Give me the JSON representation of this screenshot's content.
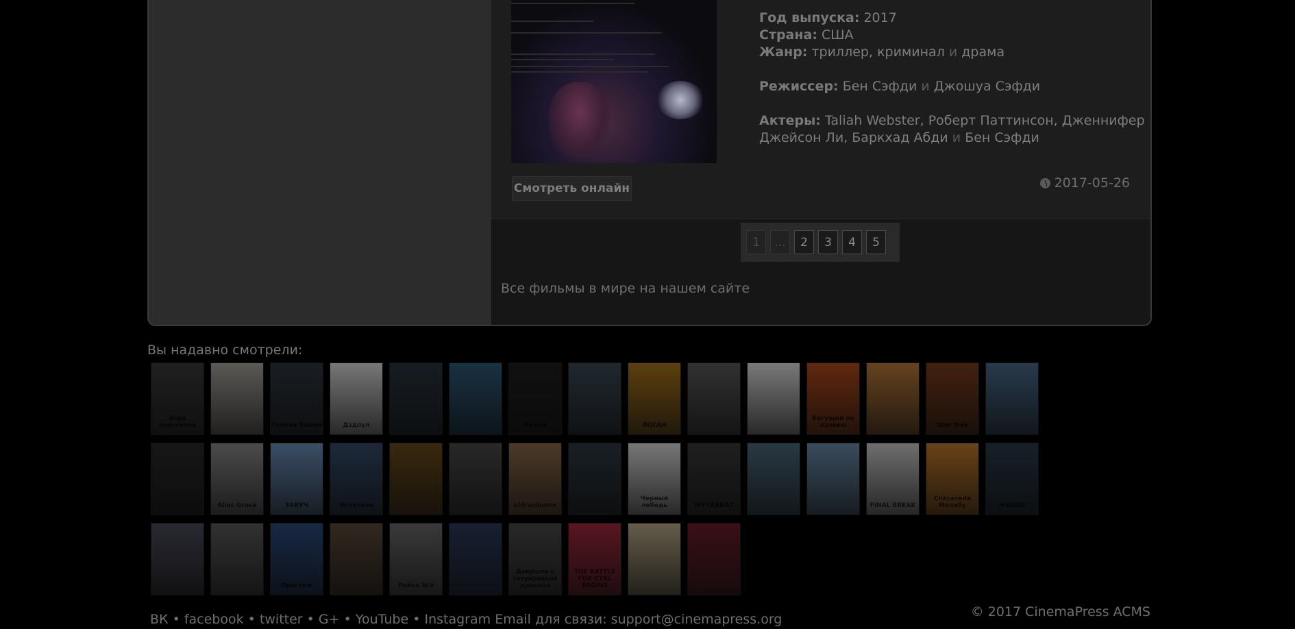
{
  "movie": {
    "watch_button": "Смотреть онлайн",
    "year_label": "Год выпуска:",
    "year": "2017",
    "country_label": "Страна:",
    "country": "США",
    "genre_label": "Жанр:",
    "genre1": "триллер",
    "genre2": "криминал",
    "genre3": "драма",
    "director_label": "Режиссер:",
    "director1": "Бен Сэфди",
    "director2": "Джошуа Сэфди",
    "actors_label": "Актеры:",
    "actor1": "Taliah Webster",
    "actor2": "Роберт Паттинсон",
    "actor3": "Дженнифер",
    "actor3b": "Джейсон Ли",
    "actor4": "Баркхад Абди",
    "actor5": "Бен Сэфди",
    "sep_comma": ",",
    "sep_and": "и",
    "date": "2017-05-26"
  },
  "pagination": {
    "pages": [
      "1",
      "...",
      "2",
      "3",
      "4",
      "5"
    ]
  },
  "tagline": "Все фильмы в мире на нашем сайте",
  "recent": {
    "title": "Вы надавно смотрели:",
    "items": [
      {
        "label": "Игра престолов",
        "color": "#3a3a3a"
      },
      {
        "label": "",
        "color": "#a6a39d"
      },
      {
        "label": "Тёмная башня",
        "color": "#2f3740"
      },
      {
        "label": "Дэдпул",
        "color": "#d9d9d9"
      },
      {
        "label": "",
        "color": "#2b3540"
      },
      {
        "label": "",
        "color": "#2f5a78"
      },
      {
        "label": "Чужой",
        "color": "#1e1e1e"
      },
      {
        "label": "",
        "color": "#3b4a55"
      },
      {
        "label": "ЛОГАН",
        "color": "#a8741c"
      },
      {
        "label": "",
        "color": "#5a5a5a"
      },
      {
        "label": "",
        "color": "#dcdcdc"
      },
      {
        "label": "Бегущий по лезвию",
        "color": "#b04a1c"
      },
      {
        "label": "",
        "color": "#b87a3c"
      },
      {
        "label": "Star Trek",
        "color": "#7a3c1c"
      },
      {
        "label": "",
        "color": "#4a6a8a"
      },
      {
        "label": "",
        "color": "#2a2a2a"
      },
      {
        "label": "Alias Grace",
        "color": "#8a8a8a"
      },
      {
        "label": "ЗАВУЧ",
        "color": "#6a8fb8"
      },
      {
        "label": "Мстители",
        "color": "#354a6a"
      },
      {
        "label": "",
        "color": "#6a4a1c"
      },
      {
        "label": "",
        "color": "#4a4a4a"
      },
      {
        "label": "oldгаrdemm",
        "color": "#8a6a4a"
      },
      {
        "label": "",
        "color": "#2e3a44"
      },
      {
        "label": "Черный лебедь",
        "color": "#d8d8d8"
      },
      {
        "label": "МУХАББАТ",
        "color": "#3a3a3a"
      },
      {
        "label": "",
        "color": "#4a6a7a"
      },
      {
        "label": "",
        "color": "#6a8aaa"
      },
      {
        "label": "FINAL BREAK",
        "color": "#cacaca"
      },
      {
        "label": "Спасатели Малибу",
        "color": "#c07a2c"
      },
      {
        "label": "ЖИВОЕ",
        "color": "#2a3a4a"
      },
      {
        "label": "",
        "color": "#4a4a5a"
      },
      {
        "label": "",
        "color": "#5a5a5a"
      },
      {
        "label": "Престиж",
        "color": "#2a4a7a"
      },
      {
        "label": "",
        "color": "#5a4a3a"
      },
      {
        "label": "Район №9",
        "color": "#6a6a6a"
      },
      {
        "label": "",
        "color": "#2a3a5a"
      },
      {
        "label": "Девушка с татуировкой дракона",
        "color": "#4a4a4a"
      },
      {
        "label": "THE BATTLE FOR CTRL BEGINS",
        "color": "#a0283c"
      },
      {
        "label": "",
        "color": "#b8a888"
      },
      {
        "label": "",
        "color": "#6a1e28"
      }
    ]
  },
  "footer": {
    "links": [
      "ВК",
      "facebook",
      "twitter",
      "G+",
      "YouTube",
      "Instagram"
    ],
    "bullet": "•",
    "email_label": "Email для связи:",
    "email": "support@cinemapress.org",
    "copyright": "© 2017 CinemaPress ACMS"
  }
}
